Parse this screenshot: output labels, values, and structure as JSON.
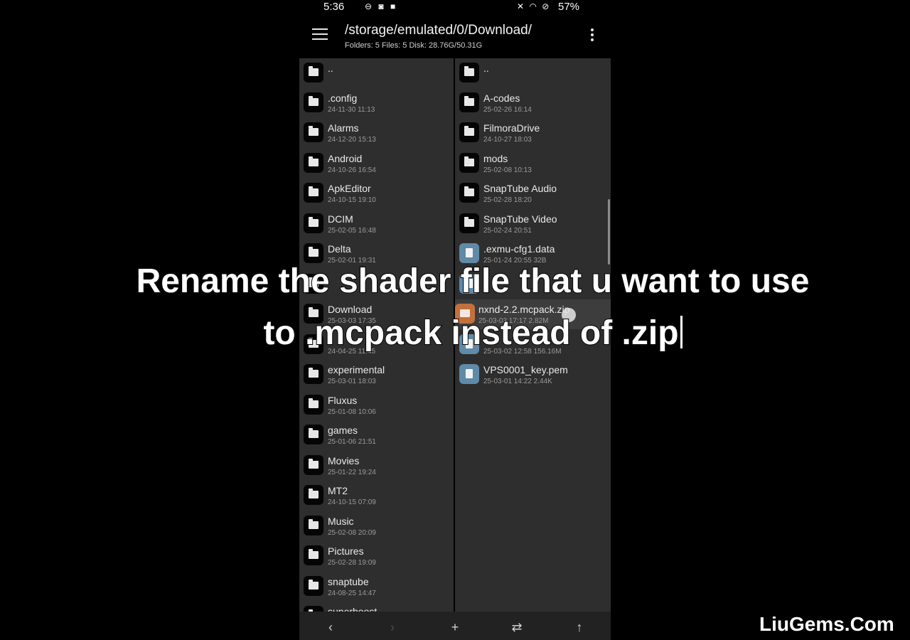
{
  "status_bar": {
    "time": "5:36",
    "battery": "57%"
  },
  "header": {
    "path": "/storage/emulated/0/Download/",
    "stats": "Folders: 5  Files: 5  Disk: 28.76G/50.31G"
  },
  "left_pane": {
    "items": [
      {
        "name": "..",
        "meta": ""
      },
      {
        "name": ".config",
        "meta": "24-11-30 11:13"
      },
      {
        "name": "Alarms",
        "meta": "24-12-20 15:13"
      },
      {
        "name": "Android",
        "meta": "24-10-26 16:54"
      },
      {
        "name": "ApkEditor",
        "meta": "24-10-15 19:10"
      },
      {
        "name": "DCIM",
        "meta": "25-02-05 16:48"
      },
      {
        "name": "Delta",
        "meta": "25-02-01 19:31"
      },
      {
        "name": "",
        "meta": ""
      },
      {
        "name": "Download",
        "meta": "25-03-03 17:35"
      },
      {
        "name": "",
        "meta": "24-04-25 11:45"
      },
      {
        "name": "experimental",
        "meta": "25-03-01 18:03"
      },
      {
        "name": "Fluxus",
        "meta": "25-01-08 10:06"
      },
      {
        "name": "games",
        "meta": "25-01-06 21:51"
      },
      {
        "name": "Movies",
        "meta": "25-01-22 19:24"
      },
      {
        "name": "MT2",
        "meta": "24-10-15 07:09"
      },
      {
        "name": "Music",
        "meta": "25-02-08 20:09"
      },
      {
        "name": "Pictures",
        "meta": "25-02-28 19:09"
      },
      {
        "name": "snaptube",
        "meta": "24-08-25 14:47"
      },
      {
        "name": "superboost",
        "meta": ""
      }
    ]
  },
  "right_pane": {
    "items": [
      {
        "name": "..",
        "meta": "",
        "kind": "folder"
      },
      {
        "name": "A-codes",
        "meta": "25-02-26 16:14",
        "kind": "folder"
      },
      {
        "name": "FilmoraDrive",
        "meta": "24-10-27 18:03",
        "kind": "folder"
      },
      {
        "name": "mods",
        "meta": "25-02-08 10:13",
        "kind": "folder"
      },
      {
        "name": "SnapTube Audio",
        "meta": "25-02-28 18:20",
        "kind": "folder"
      },
      {
        "name": "SnapTube Video",
        "meta": "25-02-24 20:51",
        "kind": "folder"
      },
      {
        "name": ".exmu-cfg1.data",
        "meta": "25-01-24 20:55  32B",
        "kind": "file"
      },
      {
        "name": "",
        "meta": "",
        "kind": "file"
      },
      {
        "name": "nxnd-2.2.mcpack.zip",
        "meta": "25-03-03 17:17  2.82M",
        "kind": "zip"
      },
      {
        "name": "",
        "meta": "25-03-02 12:58  156.16M",
        "kind": "file"
      },
      {
        "name": "VPS0001_key.pem",
        "meta": "25-03-01 14:22  2.44K",
        "kind": "file"
      }
    ]
  },
  "bottom_bar": {
    "back": "‹",
    "forward": "›",
    "add": "+",
    "swap": "⇄",
    "up": "↑"
  },
  "caption": {
    "line1": "Rename the shader file that u want to use",
    "line2": "to .mcpack instead of .zip"
  },
  "watermark": "LiuGems.Com",
  "colors": {
    "background": "#000000",
    "pane": "#2e2e2e",
    "selected": "#3d3d3d",
    "file_icon": "#5f8aa8",
    "zip_icon": "#c2703e"
  }
}
